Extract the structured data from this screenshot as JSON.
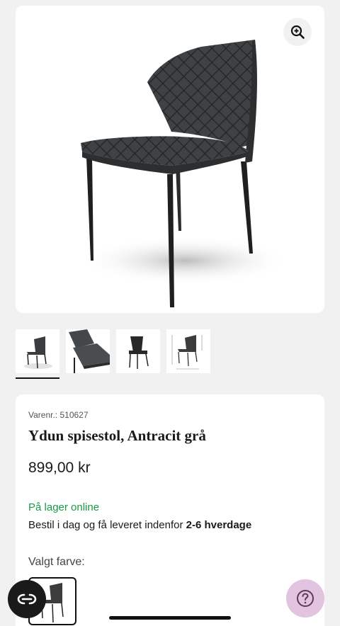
{
  "product": {
    "sku": "Varenr.: 510627",
    "title": "Ydun spisestol, Antracit grå",
    "price": "899,00 kr",
    "stock": "På lager online",
    "delivery_prefix": "Bestil i dag og få leveret indenfor ",
    "delivery_days": "2-6 hverdage",
    "color_label": "Valgt farve:"
  },
  "gallery": {
    "thumbnails": [
      {
        "name": "chair-front-view",
        "active": true
      },
      {
        "name": "chair-seat-closeup",
        "active": false
      },
      {
        "name": "chair-back-view",
        "active": false
      },
      {
        "name": "chair-dimensions",
        "active": false
      }
    ]
  },
  "icons": {
    "zoom": "zoom-in-icon",
    "chat": "chat-icon",
    "help": "help-icon"
  },
  "colors": {
    "stock_green": "#1a9a44",
    "help_button": "#e2c4e0",
    "chat_button": "#1a1a1a"
  }
}
